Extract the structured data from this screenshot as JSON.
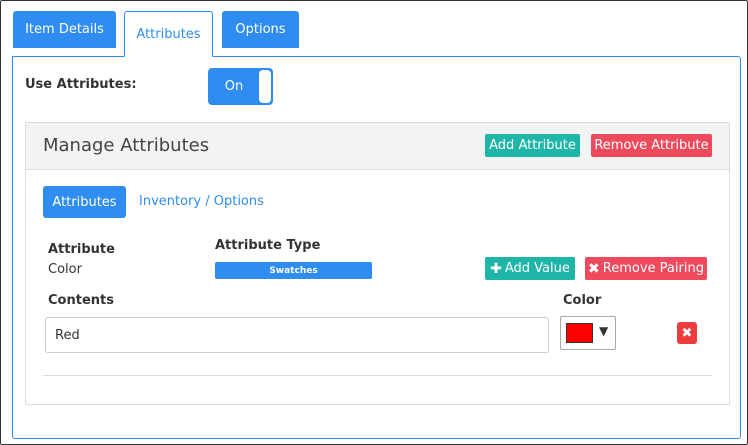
{
  "tabs": [
    {
      "label": "Item Details"
    },
    {
      "label": "Attributes"
    },
    {
      "label": "Options"
    }
  ],
  "use_attributes": {
    "label": "Use Attributes:",
    "toggle_state": "On"
  },
  "manage": {
    "title": "Manage Attributes",
    "add_attribute_label": "Add Attribute",
    "remove_attribute_label": "Remove Attribute",
    "subtabs": [
      {
        "label": "Attributes",
        "active": true
      },
      {
        "label": "Inventory / Options",
        "active": false
      }
    ],
    "attribute_header": "Attribute",
    "attribute_value": "Color",
    "type_header": "Attribute Type",
    "type_value": "Swatches",
    "add_value_label": "Add Value",
    "remove_pairing_label": "Remove Pairing",
    "contents_header": "Contents",
    "color_header": "Color",
    "rows": [
      {
        "contents": "Red",
        "color": "#ff0000"
      }
    ]
  },
  "colors": {
    "accent": "#2f8cf0",
    "teal": "#1fb5a8",
    "danger": "#ee4a5d"
  }
}
